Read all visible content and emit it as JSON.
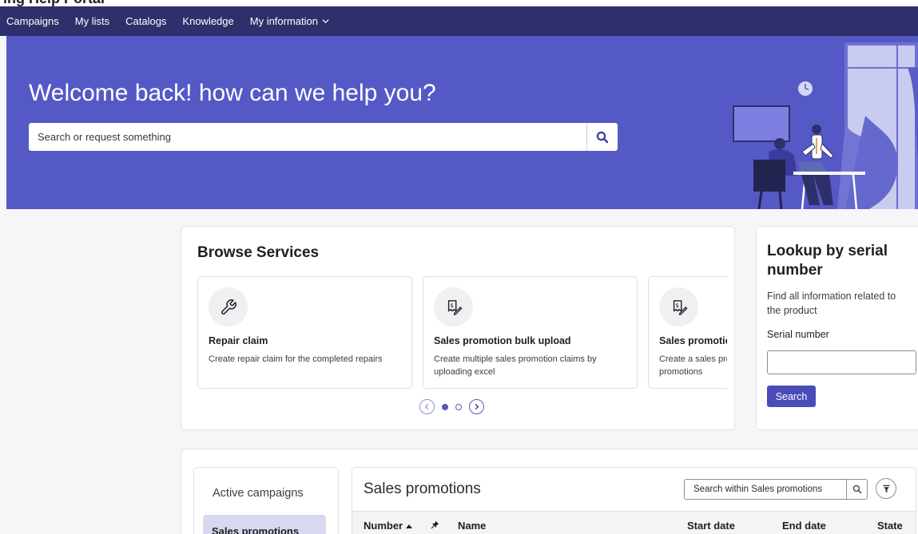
{
  "page_header": {
    "partial_title": "ing Help Portal"
  },
  "nav": {
    "items": [
      "Campaigns",
      "My lists",
      "Catalogs",
      "Knowledge"
    ],
    "dropdown_label": "My information"
  },
  "hero": {
    "title": "Welcome back! how can we help you?",
    "search_placeholder": "Search or request something"
  },
  "browse": {
    "title": "Browse Services",
    "services": [
      {
        "title": "Repair claim",
        "description": "Create repair claim for the completed repairs",
        "icon": "wrench-icon"
      },
      {
        "title": "Sales promotion bulk upload",
        "description": "Create multiple sales promotion claims by uploading excel",
        "icon": "receipt-icon"
      },
      {
        "title": "Sales promotion",
        "description": "Create a sales promotion claim for all sales promotions",
        "icon": "receipt-icon"
      }
    ],
    "pages": 2,
    "active_page": 1
  },
  "lookup": {
    "title": "Lookup by serial number",
    "description": "Find all information related to the product",
    "field_label": "Serial number",
    "field_value": "",
    "button_label": "Search"
  },
  "campaigns": {
    "side_title": "Active campaigns",
    "side_items": [
      "Sales promotions"
    ],
    "table_title": "Sales promotions",
    "search_placeholder": "Search within Sales promotions",
    "columns": [
      "Number",
      "Name",
      "Start date",
      "End date",
      "State"
    ]
  },
  "colors": {
    "nav": "#2f2f6b",
    "hero": "#5559c6",
    "accent": "#4a4db8",
    "selected": "#d8d9f0"
  }
}
